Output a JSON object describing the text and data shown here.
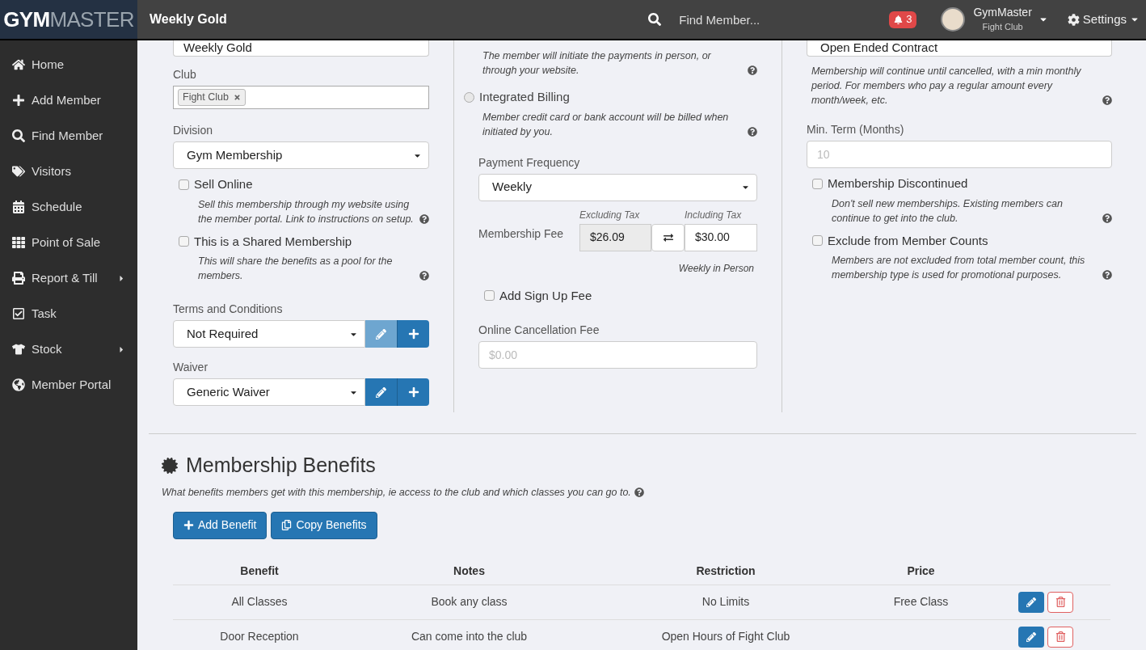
{
  "header": {
    "logo_bold": "GYM",
    "logo_light": "MASTER",
    "title": "Weekly Gold",
    "search_placeholder": "Find Member...",
    "notifications": "3",
    "user_name": "GymMaster",
    "user_club": "Fight Club",
    "settings": "Settings"
  },
  "sidebar": {
    "items": [
      {
        "label": "Home",
        "has_submenu": false
      },
      {
        "label": "Add Member",
        "has_submenu": false
      },
      {
        "label": "Find Member",
        "has_submenu": false
      },
      {
        "label": "Visitors",
        "has_submenu": false
      },
      {
        "label": "Schedule",
        "has_submenu": false
      },
      {
        "label": "Point of Sale",
        "has_submenu": false
      },
      {
        "label": "Report & Till",
        "has_submenu": true
      },
      {
        "label": "Task",
        "has_submenu": false
      },
      {
        "label": "Stock",
        "has_submenu": true
      },
      {
        "label": "Member Portal",
        "has_submenu": false
      }
    ]
  },
  "left": {
    "name_value": "Weekly Gold",
    "club": {
      "label": "Club",
      "tags": [
        "Fight Club"
      ]
    },
    "division": {
      "label": "Division",
      "value": "Gym Membership"
    },
    "checks": [
      {
        "label": "Sell Online",
        "checked": false,
        "description": "Sell this membership through my website using the member portal. Link to instructions on setup."
      },
      {
        "label": "This is a Shared Membership",
        "checked": false,
        "description": "This will share the benefits as a pool for the members."
      }
    ],
    "selects": [
      {
        "label": "Terms and Conditions",
        "value": "Not Required",
        "edit_disabled": true
      },
      {
        "label": "Waiver",
        "value": "Generic Waiver",
        "edit_disabled": false
      }
    ]
  },
  "middle": {
    "billing_hint": "The member will initiate the payments in person, or through your website.",
    "integrated": {
      "label": "Integrated Billing",
      "selected": false,
      "description": "Member credit card or bank account will be billed when initiated by you."
    },
    "payment_frequency": {
      "label": "Payment Frequency",
      "value": "Weekly"
    },
    "fee": {
      "label": "Membership Fee",
      "excluding_label": "Excluding Tax",
      "excluding_value": "$26.09",
      "including_label": "Including Tax",
      "including_value": "$30.00",
      "note": "Weekly in Person"
    },
    "signup": {
      "label": "Add Sign Up Fee",
      "checked": false
    },
    "cancellation": {
      "label": "Online Cancellation Fee",
      "placeholder": "$0.00"
    }
  },
  "right": {
    "contract_value": "Open Ended Contract",
    "contract_hint": "Membership will continue until cancelled, with a min monthly period. For members who pay a regular amount every month/week, etc.",
    "min_term": {
      "label": "Min. Term (Months)",
      "placeholder": "10"
    },
    "checks": [
      {
        "label": "Membership Discontinued",
        "checked": false,
        "description": "Don't sell new memberships. Existing members can continue to get into the club."
      },
      {
        "label": "Exclude from Member Counts",
        "checked": false,
        "description": "Members are not excluded from total member count, this membership type is used for promotional purposes."
      }
    ]
  },
  "benefits": {
    "title": "Membership Benefits",
    "subtitle": "What benefits members get with this membership, ie access to the club and which classes you can go to.",
    "buttons": [
      "Add Benefit",
      "Copy Benefits"
    ],
    "columns": [
      "Benefit",
      "Notes",
      "Restriction",
      "Price"
    ],
    "rows": [
      [
        "All Classes",
        "Book any class",
        "No Limits",
        "Free Class"
      ],
      [
        "Door Reception",
        "Can come into the club",
        "Open Hours of Fight Club",
        ""
      ]
    ]
  }
}
